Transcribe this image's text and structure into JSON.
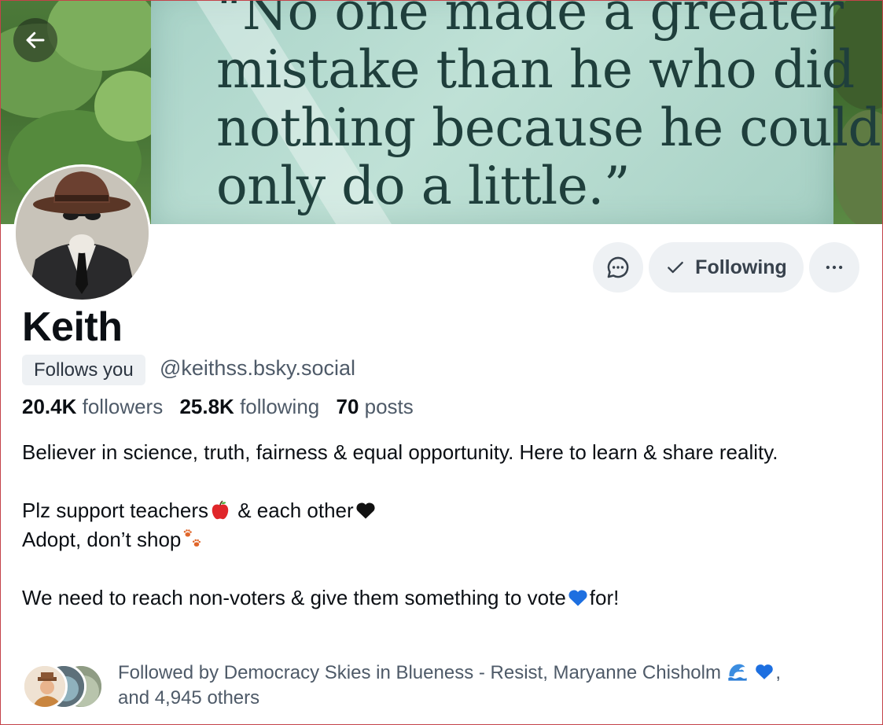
{
  "banner": {
    "quote_lines": [
      "“No one made a greater",
      "mistake than he who did",
      "nothing because he could",
      "only do a little.”"
    ]
  },
  "profile": {
    "display_name": "Keith",
    "follows_you_label": "Follows you",
    "handle": "@keithss.bsky.social",
    "followers_count": "20.4K",
    "followers_label": "followers",
    "following_count": "25.8K",
    "following_label": "following",
    "posts_count": "70",
    "posts_label": "posts"
  },
  "actions": {
    "message_icon": "chat-bubble-icon",
    "following_label": "Following",
    "more_icon": "ellipsis-icon"
  },
  "bio": {
    "line1": "Believer in science, truth, fairness & equal opportunity. Here to learn & share reality.",
    "line2a": "Plz support teachers",
    "line2b": " & each other",
    "line3": "Adopt, don’t shop",
    "line4a": "We need to reach non-voters & give them something to vote",
    "line4b": "for!"
  },
  "followed_by": {
    "text_line1": "Followed by Democracy Skies in Blueness - Resist, Maryanne Chisholm",
    "text_line2": "and 4,945 others"
  },
  "colors": {
    "accent_text": "#0b0f14",
    "muted_text": "#4e5a68",
    "button_bg": "#eef1f4",
    "heart_blue": "#1d6fe0"
  }
}
